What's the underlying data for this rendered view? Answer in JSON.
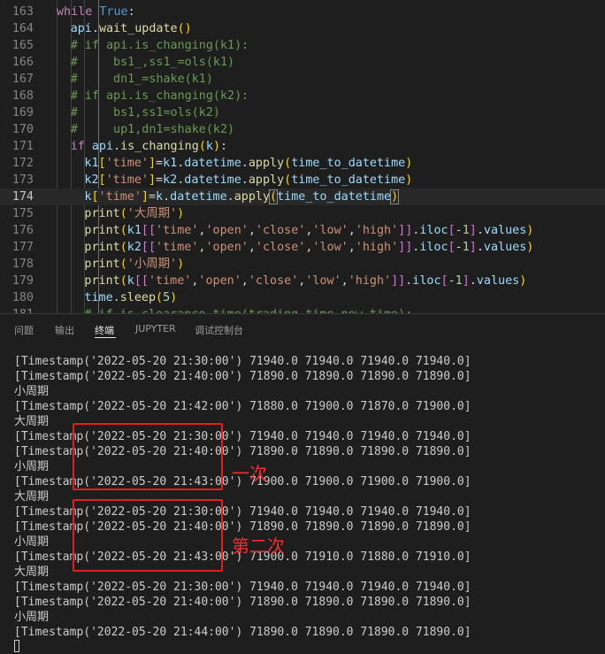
{
  "editor": {
    "lines": [
      {
        "n": "163",
        "segs": [
          [
            "kw",
            "while"
          ],
          [
            "op",
            " "
          ],
          [
            "bool",
            "True"
          ],
          [
            "op",
            ":"
          ]
        ]
      },
      {
        "n": "164",
        "segs": [
          [
            "var",
            "api"
          ],
          [
            "op",
            "."
          ],
          [
            "fn",
            "wait_update"
          ],
          [
            "br1",
            "()"
          ]
        ]
      },
      {
        "n": "165",
        "segs": [
          [
            "cmt",
            "# if api.is_changing(k1):"
          ]
        ]
      },
      {
        "n": "166",
        "segs": [
          [
            "cmt",
            "#     bs1_,ss1_=ols(k1)"
          ]
        ]
      },
      {
        "n": "167",
        "segs": [
          [
            "cmt",
            "#     dn1_=shake(k1)"
          ]
        ]
      },
      {
        "n": "168",
        "segs": [
          [
            "cmt",
            "# if api.is_changing(k2):"
          ]
        ]
      },
      {
        "n": "169",
        "segs": [
          [
            "cmt",
            "#     bs1,ss1=ols(k2)"
          ]
        ]
      },
      {
        "n": "170",
        "segs": [
          [
            "cmt",
            "#     up1,dn1=shake(k2)"
          ]
        ]
      },
      {
        "n": "171",
        "segs": [
          [
            "kw",
            "if"
          ],
          [
            "op",
            " "
          ],
          [
            "var",
            "api"
          ],
          [
            "op",
            "."
          ],
          [
            "fn",
            "is_changing"
          ],
          [
            "br1",
            "("
          ],
          [
            "var",
            "k"
          ],
          [
            "br1",
            ")"
          ],
          [
            "op",
            ":"
          ]
        ]
      },
      {
        "n": "172",
        "segs": [
          [
            "var",
            "k1"
          ],
          [
            "br1",
            "["
          ],
          [
            "str",
            "'time'"
          ],
          [
            "br1",
            "]"
          ],
          [
            "op",
            "="
          ],
          [
            "var",
            "k1"
          ],
          [
            "op",
            "."
          ],
          [
            "var",
            "datetime"
          ],
          [
            "op",
            "."
          ],
          [
            "fn",
            "apply"
          ],
          [
            "br1",
            "("
          ],
          [
            "var",
            "time_to_datetime"
          ],
          [
            "br1",
            ")"
          ]
        ]
      },
      {
        "n": "173",
        "segs": [
          [
            "var",
            "k2"
          ],
          [
            "br1",
            "["
          ],
          [
            "str",
            "'time'"
          ],
          [
            "br1",
            "]"
          ],
          [
            "op",
            "="
          ],
          [
            "var",
            "k2"
          ],
          [
            "op",
            "."
          ],
          [
            "var",
            "datetime"
          ],
          [
            "op",
            "."
          ],
          [
            "fn",
            "apply"
          ],
          [
            "br1",
            "("
          ],
          [
            "var",
            "time_to_datetime"
          ],
          [
            "br1",
            ")"
          ]
        ]
      },
      {
        "n": "174",
        "segs": [
          [
            "var",
            "k"
          ],
          [
            "br1",
            "["
          ],
          [
            "str",
            "'time'"
          ],
          [
            "br1",
            "]"
          ],
          [
            "op",
            "="
          ],
          [
            "var",
            "k"
          ],
          [
            "op",
            "."
          ],
          [
            "var",
            "datetime"
          ],
          [
            "op",
            "."
          ],
          [
            "fn",
            "apply"
          ],
          [
            "br1m",
            "("
          ],
          [
            "var",
            "time_to_datetime"
          ],
          [
            "br1m",
            ")"
          ]
        ]
      },
      {
        "n": "175",
        "segs": [
          [
            "fn",
            "print"
          ],
          [
            "br1",
            "("
          ],
          [
            "str",
            "'大周期'"
          ],
          [
            "br1",
            ")"
          ]
        ]
      },
      {
        "n": "176",
        "segs": [
          [
            "fn",
            "print"
          ],
          [
            "br1",
            "("
          ],
          [
            "var",
            "k1"
          ],
          [
            "br2",
            "[["
          ],
          [
            "str",
            "'time'"
          ],
          [
            "op",
            ","
          ],
          [
            "str",
            "'open'"
          ],
          [
            "op",
            ","
          ],
          [
            "str",
            "'close'"
          ],
          [
            "op",
            ","
          ],
          [
            "str",
            "'low'"
          ],
          [
            "op",
            ","
          ],
          [
            "str",
            "'high'"
          ],
          [
            "br2",
            "]]"
          ],
          [
            "op",
            "."
          ],
          [
            "var",
            "iloc"
          ],
          [
            "br2",
            "["
          ],
          [
            "op",
            "-"
          ],
          [
            "num",
            "1"
          ],
          [
            "br2",
            "]"
          ],
          [
            "op",
            "."
          ],
          [
            "var",
            "values"
          ],
          [
            "br1",
            ")"
          ]
        ]
      },
      {
        "n": "177",
        "segs": [
          [
            "fn",
            "print"
          ],
          [
            "br1",
            "("
          ],
          [
            "var",
            "k2"
          ],
          [
            "br2",
            "[["
          ],
          [
            "str",
            "'time'"
          ],
          [
            "op",
            ","
          ],
          [
            "str",
            "'open'"
          ],
          [
            "op",
            ","
          ],
          [
            "str",
            "'close'"
          ],
          [
            "op",
            ","
          ],
          [
            "str",
            "'low'"
          ],
          [
            "op",
            ","
          ],
          [
            "str",
            "'high'"
          ],
          [
            "br2",
            "]]"
          ],
          [
            "op",
            "."
          ],
          [
            "var",
            "iloc"
          ],
          [
            "br2",
            "["
          ],
          [
            "op",
            "-"
          ],
          [
            "num",
            "1"
          ],
          [
            "br2",
            "]"
          ],
          [
            "op",
            "."
          ],
          [
            "var",
            "values"
          ],
          [
            "br1",
            ")"
          ]
        ]
      },
      {
        "n": "178",
        "segs": [
          [
            "fn",
            "print"
          ],
          [
            "br1",
            "("
          ],
          [
            "str",
            "'小周期'"
          ],
          [
            "br1",
            ")"
          ]
        ]
      },
      {
        "n": "179",
        "segs": [
          [
            "fn",
            "print"
          ],
          [
            "br1",
            "("
          ],
          [
            "var",
            "k"
          ],
          [
            "br2",
            "[["
          ],
          [
            "str",
            "'time'"
          ],
          [
            "op",
            ","
          ],
          [
            "str",
            "'open'"
          ],
          [
            "op",
            ","
          ],
          [
            "str",
            "'close'"
          ],
          [
            "op",
            ","
          ],
          [
            "str",
            "'low'"
          ],
          [
            "op",
            ","
          ],
          [
            "str",
            "'high'"
          ],
          [
            "br2",
            "]]"
          ],
          [
            "op",
            "."
          ],
          [
            "var",
            "iloc"
          ],
          [
            "br2",
            "["
          ],
          [
            "op",
            "-"
          ],
          [
            "num",
            "1"
          ],
          [
            "br2",
            "]"
          ],
          [
            "op",
            "."
          ],
          [
            "var",
            "values"
          ],
          [
            "br1",
            ")"
          ]
        ]
      },
      {
        "n": "180",
        "segs": [
          [
            "var",
            "time"
          ],
          [
            "op",
            "."
          ],
          [
            "fn",
            "sleep"
          ],
          [
            "br1",
            "("
          ],
          [
            "num",
            "5"
          ],
          [
            "br1",
            ")"
          ]
        ]
      },
      {
        "n": "181",
        "segs": [
          [
            "cmt",
            "# if is_clearance_time(trading_time,now_time):"
          ]
        ]
      }
    ],
    "active_line": "174"
  },
  "panel": {
    "tabs": [
      "问题",
      "输出",
      "终端",
      "JUPYTER",
      "调试控制台"
    ],
    "active_tab": "终端"
  },
  "terminal": {
    "lines": [
      "[Timestamp('2022-05-20 21:30:00') 71940.0 71940.0 71940.0 71940.0]",
      "[Timestamp('2022-05-20 21:40:00') 71890.0 71890.0 71890.0 71890.0]",
      "小周期",
      "[Timestamp('2022-05-20 21:42:00') 71880.0 71900.0 71870.0 71900.0]",
      "大周期",
      "[Timestamp('2022-05-20 21:30:00') 71940.0 71940.0 71940.0 71940.0]",
      "[Timestamp('2022-05-20 21:40:00') 71890.0 71890.0 71890.0 71890.0]",
      "小周期",
      "[Timestamp('2022-05-20 21:43:00') 71900.0 71900.0 71900.0 71900.0]",
      "大周期",
      "[Timestamp('2022-05-20 21:30:00') 71940.0 71940.0 71940.0 71940.0]",
      "[Timestamp('2022-05-20 21:40:00') 71890.0 71890.0 71890.0 71890.0]",
      "小周期",
      "[Timestamp('2022-05-20 21:43:00') 71900.0 71910.0 71880.0 71910.0]",
      "大周期",
      "[Timestamp('2022-05-20 21:30:00') 71940.0 71940.0 71940.0 71940.0]",
      "[Timestamp('2022-05-20 21:40:00') 71890.0 71890.0 71890.0 71890.0]",
      "小周期",
      "[Timestamp('2022-05-20 21:44:00') 71890.0 71890.0 71890.0 71890.0]"
    ]
  },
  "annotations": {
    "first": "一次",
    "second": "第二次",
    "color": "#e02020"
  }
}
